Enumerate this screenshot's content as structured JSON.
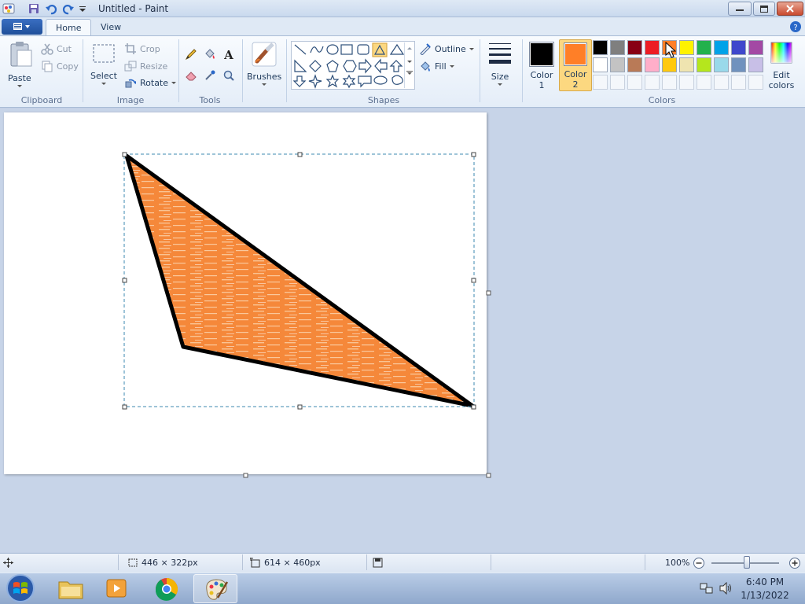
{
  "window": {
    "title": "Untitled - Paint"
  },
  "tabs": [
    {
      "label": "Home"
    },
    {
      "label": "View"
    }
  ],
  "clipboard": {
    "paste": "Paste",
    "cut": "Cut",
    "copy": "Copy",
    "group": "Clipboard"
  },
  "image": {
    "select": "Select",
    "crop": "Crop",
    "resize": "Resize",
    "rotate": "Rotate",
    "group": "Image"
  },
  "tools": {
    "group": "Tools"
  },
  "brushes": {
    "label": "Brushes"
  },
  "shapes": {
    "outline": "Outline",
    "fill": "Fill",
    "group": "Shapes"
  },
  "size": {
    "label": "Size"
  },
  "colors": {
    "color1_label": "Color",
    "color1_num": "1",
    "color2_label": "Color",
    "color2_num": "2",
    "color1": "#000000",
    "color2": "#ff7f27",
    "edit_label": "Edit",
    "edit_label2": "colors",
    "group": "Colors",
    "palette_row1": [
      "#000000",
      "#7f7f7f",
      "#880015",
      "#ed1c24",
      "#ff7f27",
      "#fff200",
      "#22b14c",
      "#00a2e8",
      "#3f48cc",
      "#a349a4"
    ],
    "palette_row2": [
      "#ffffff",
      "#c3c3c3",
      "#b97a57",
      "#ffaec9",
      "#ffc90e",
      "#efe4b0",
      "#b5e61d",
      "#99d9ea",
      "#7092be",
      "#c8bfe7"
    ]
  },
  "status": {
    "selection_size": "446 × 322px",
    "canvas_size": "614 × 460px",
    "zoom": "100%"
  },
  "clock": {
    "time": "6:40 PM",
    "date": "1/13/2022"
  }
}
